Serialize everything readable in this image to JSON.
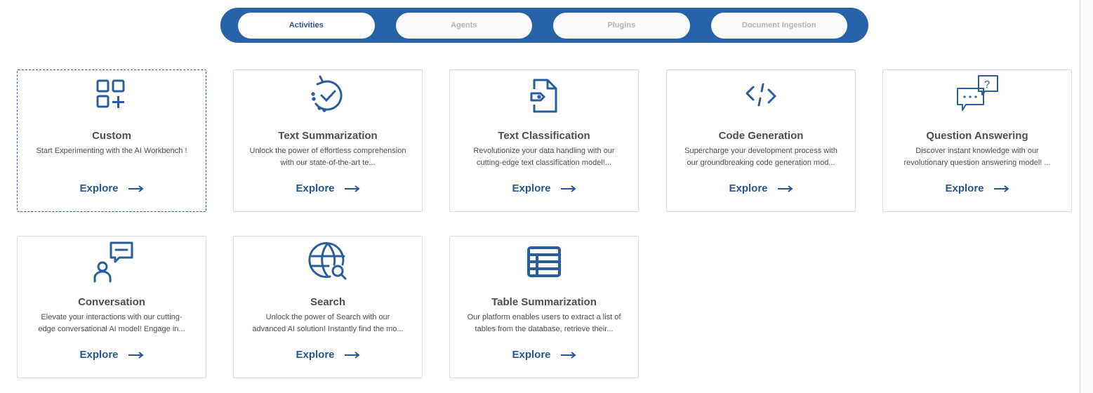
{
  "tabs": [
    {
      "label": "Activities",
      "active": true
    },
    {
      "label": "Agents",
      "active": false
    },
    {
      "label": "Plugins",
      "active": false
    },
    {
      "label": "Document Ingestion",
      "active": false
    }
  ],
  "explore_label": "Explore",
  "colors": {
    "primary": "#2761a8",
    "text": "#4d4d4d",
    "icon": "#2a5ca0"
  },
  "cards": [
    {
      "title": "Custom",
      "desc": "Start Experimenting with the AI Workbench !",
      "icon": "grid-plus-icon"
    },
    {
      "title": "Text Summarization",
      "desc": "Unlock the power of effortless comprehension with our state-of-the-art te...",
      "icon": "refresh-check-icon"
    },
    {
      "title": "Text Classification",
      "desc": "Revolutionize your data handling with our cutting-edge text classification model!...",
      "icon": "document-tag-icon"
    },
    {
      "title": "Code Generation",
      "desc": "Supercharge your development process with our groundbreaking code generation mod...",
      "icon": "code-icon"
    },
    {
      "title": "Question Answering",
      "desc": "Discover instant knowledge with our revolutionary question answering model! ...",
      "icon": "chat-question-icon"
    },
    {
      "title": "Conversation",
      "desc": "Elevate your interactions with our cutting-edge conversational AI model! Engage in...",
      "icon": "person-chat-icon"
    },
    {
      "title": "Search",
      "desc": "Unlock the power of Search with our advanced AI solution! Instantly find the mo...",
      "icon": "globe-search-icon"
    },
    {
      "title": "Table Summarization",
      "desc": "Our platform enables users to extract a list of tables from the database, retrieve their...",
      "icon": "table-icon"
    }
  ]
}
